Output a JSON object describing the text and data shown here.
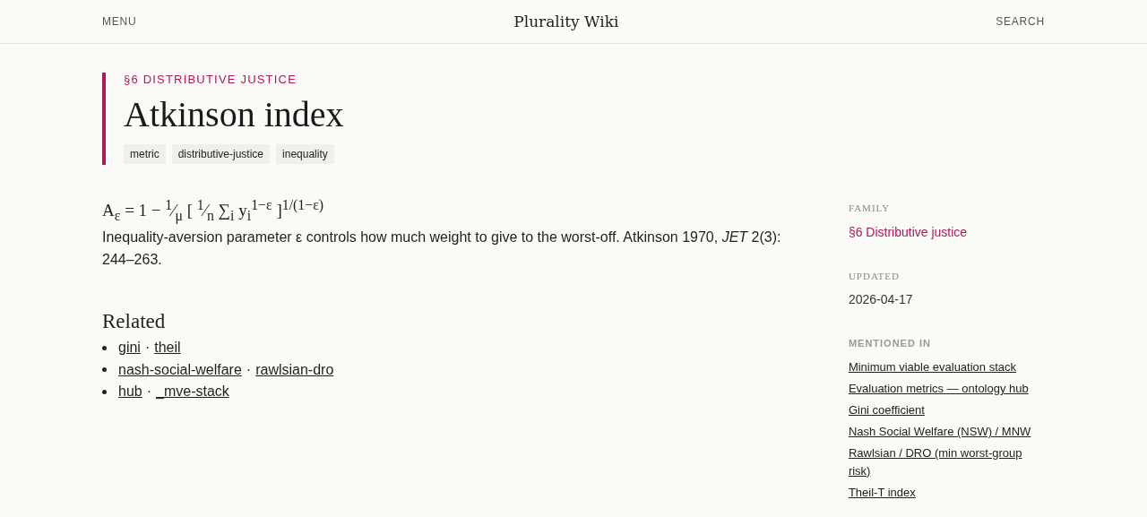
{
  "header": {
    "menu": "MENU",
    "title": "Plurality Wiki",
    "search": "SEARCH"
  },
  "article": {
    "section": "§6 DISTRIBUTIVE JUSTICE",
    "title": "Atkinson index",
    "tags": [
      "metric",
      "distributive-justice",
      "inequality"
    ],
    "formula": "A$_{ε}$ = 1 − $^{1}$⁄$_{μ}$ [ $^{1}$⁄$_{n}$ ∑$_{i}$ y$_{i}$$^{1−ε}$ ]$^{1/(1−ε)}$",
    "description": "Inequality-aversion parameter ε controls how much weight to give to the worst-off. Atkinson 1970, *JET* 2(3): 244–263.",
    "related_heading": "Related",
    "related": [
      [
        {
          "kind": "link",
          "text": "gini"
        },
        {
          "kind": "sep",
          "text": "·"
        },
        {
          "kind": "link",
          "text": "theil"
        }
      ],
      [
        {
          "kind": "link",
          "text": "nash-social-welfare"
        },
        {
          "kind": "sep",
          "text": "·"
        },
        {
          "kind": "link",
          "text": "rawlsian-dro"
        }
      ],
      [
        {
          "kind": "link",
          "text": "hub"
        },
        {
          "kind": "sep",
          "text": "·"
        },
        {
          "kind": "link",
          "text": "_mve-stack"
        }
      ]
    ]
  },
  "sidebar": {
    "family_label": "FAMILY",
    "family": "§6 Distributive justice",
    "updated_label": "UPDATED",
    "updated": "2026-04-17",
    "mentioned_label": "MENTIONED IN",
    "mentioned": [
      "Minimum viable evaluation stack",
      "Evaluation metrics — ontology hub",
      "Gini coefficient",
      "Nash Social Welfare (NSW) / MNW",
      "Rawlsian / DRO (min worst-group risk)",
      "Theil-T index"
    ]
  }
}
